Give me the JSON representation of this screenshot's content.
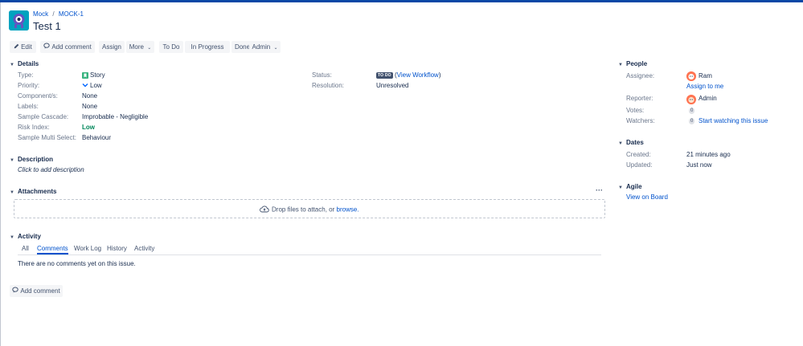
{
  "breadcrumb": {
    "project": "Mock",
    "separator": "/",
    "issue_key": "MOCK-1"
  },
  "issue": {
    "title": "Test 1"
  },
  "toolbar": {
    "edit": "Edit",
    "add_comment": "Add comment",
    "assign": "Assign",
    "more": "More",
    "todo": "To Do",
    "in_progress": "In Progress",
    "done": "Done",
    "admin": "Admin"
  },
  "details": {
    "heading": "Details",
    "type_label": "Type:",
    "type_value": "Story",
    "priority_label": "Priority:",
    "priority_value": "Low",
    "components_label": "Component/s:",
    "components_value": "None",
    "labels_label": "Labels:",
    "labels_value": "None",
    "cascade_label": "Sample Cascade:",
    "cascade_value": "Improbable - Negligible",
    "risk_label": "Risk Index:",
    "risk_value": "Low",
    "multi_label": "Sample Multi Select:",
    "multi_value": "Behaviour",
    "status_label": "Status:",
    "status_lozenge": "TO DO",
    "status_link": "View Workflow",
    "resolution_label": "Resolution:",
    "resolution_value": "Unresolved"
  },
  "description": {
    "heading": "Description",
    "placeholder": "Click to add description"
  },
  "attachments": {
    "heading": "Attachments",
    "menu": "···",
    "drop_text": "Drop files to attach, or",
    "browse": "browse."
  },
  "activity": {
    "heading": "Activity",
    "tabs": [
      "All",
      "Comments",
      "Work Log",
      "History",
      "Activity"
    ],
    "empty": "There are no comments yet on this issue.",
    "add_comment": "Add comment"
  },
  "people": {
    "heading": "People",
    "assignee_label": "Assignee:",
    "assignee": "Ram",
    "assign_to_me": "Assign to me",
    "reporter_label": "Reporter:",
    "reporter": "Admin",
    "votes_label": "Votes:",
    "votes": "0",
    "watchers_label": "Watchers:",
    "watchers": "0",
    "watch_link": "Start watching this issue"
  },
  "dates": {
    "heading": "Dates",
    "created_label": "Created:",
    "created": "21 minutes ago",
    "updated_label": "Updated:",
    "updated": "Just now"
  },
  "agile": {
    "heading": "Agile",
    "board_link": "View on Board"
  },
  "colors": {
    "accent": "#0052cc",
    "topbar": "#0747a6",
    "risk_low": "#00875a",
    "story": "#36b37e"
  }
}
